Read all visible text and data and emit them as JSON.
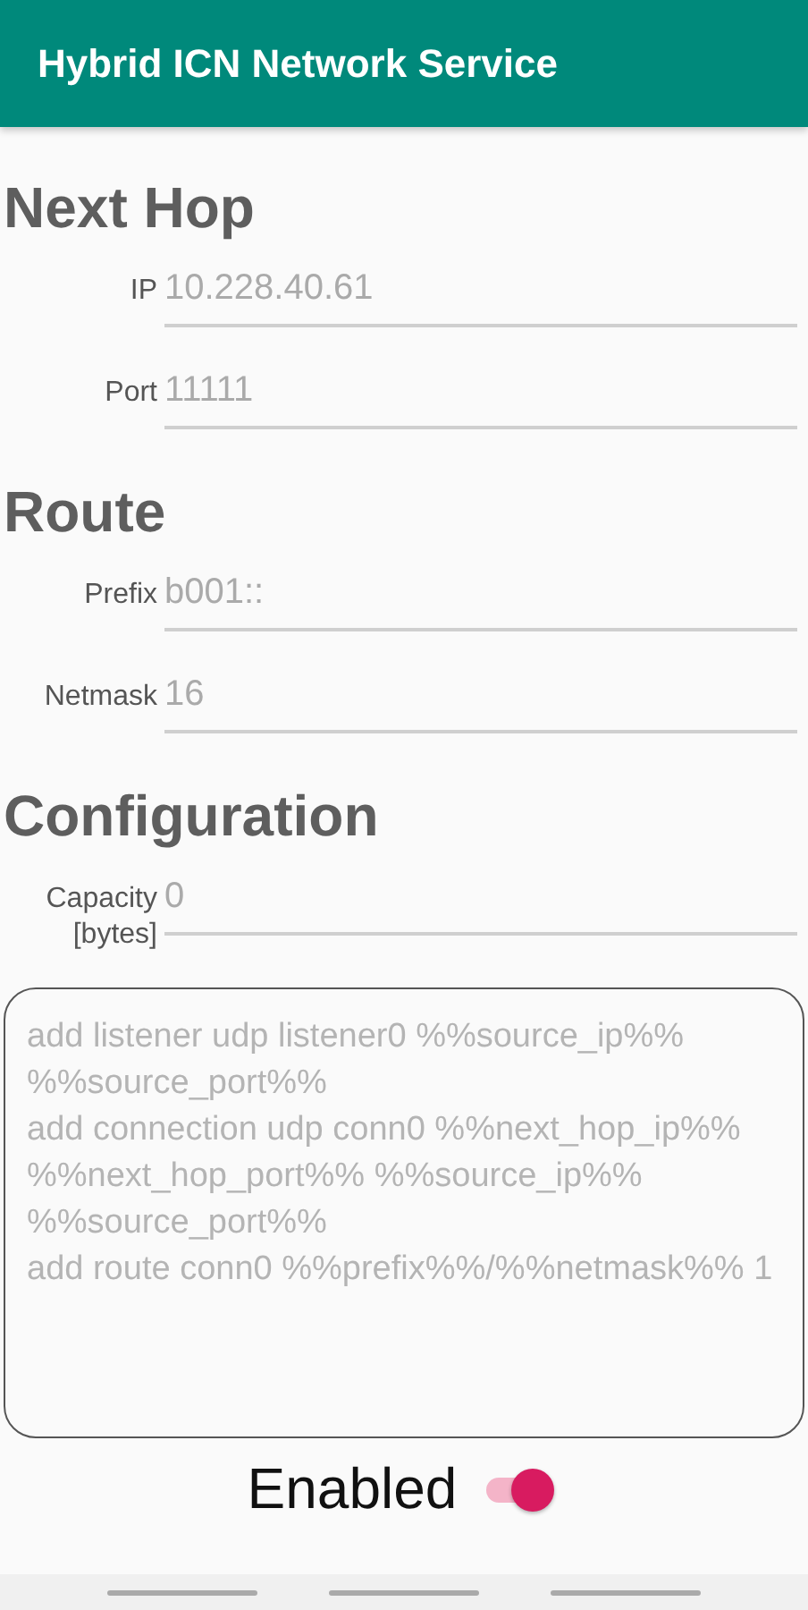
{
  "app_bar": {
    "title": "Hybrid ICN Network Service"
  },
  "sections": [
    {
      "title": "Next Hop",
      "fields": [
        {
          "label": "IP",
          "placeholder": "10.228.40.61"
        },
        {
          "label": "Port",
          "placeholder": "11111"
        }
      ]
    },
    {
      "title": "Route",
      "fields": [
        {
          "label": "Prefix",
          "placeholder": "b001::"
        },
        {
          "label": "Netmask",
          "placeholder": "16"
        }
      ]
    },
    {
      "title": "Configuration",
      "fields": [
        {
          "label": "Capacity [bytes]",
          "placeholder": "0"
        }
      ]
    }
  ],
  "config_text": {
    "placeholder": "add listener udp listener0 %%source_ip%% %%source_port%%\nadd connection udp conn0 %%next_hop_ip%% %%next_hop_port%% %%source_ip%% %%source_port%%\nadd route conn0 %%prefix%%/%%netmask%% 1"
  },
  "enabled_switch": {
    "label": "Enabled",
    "on": true
  }
}
